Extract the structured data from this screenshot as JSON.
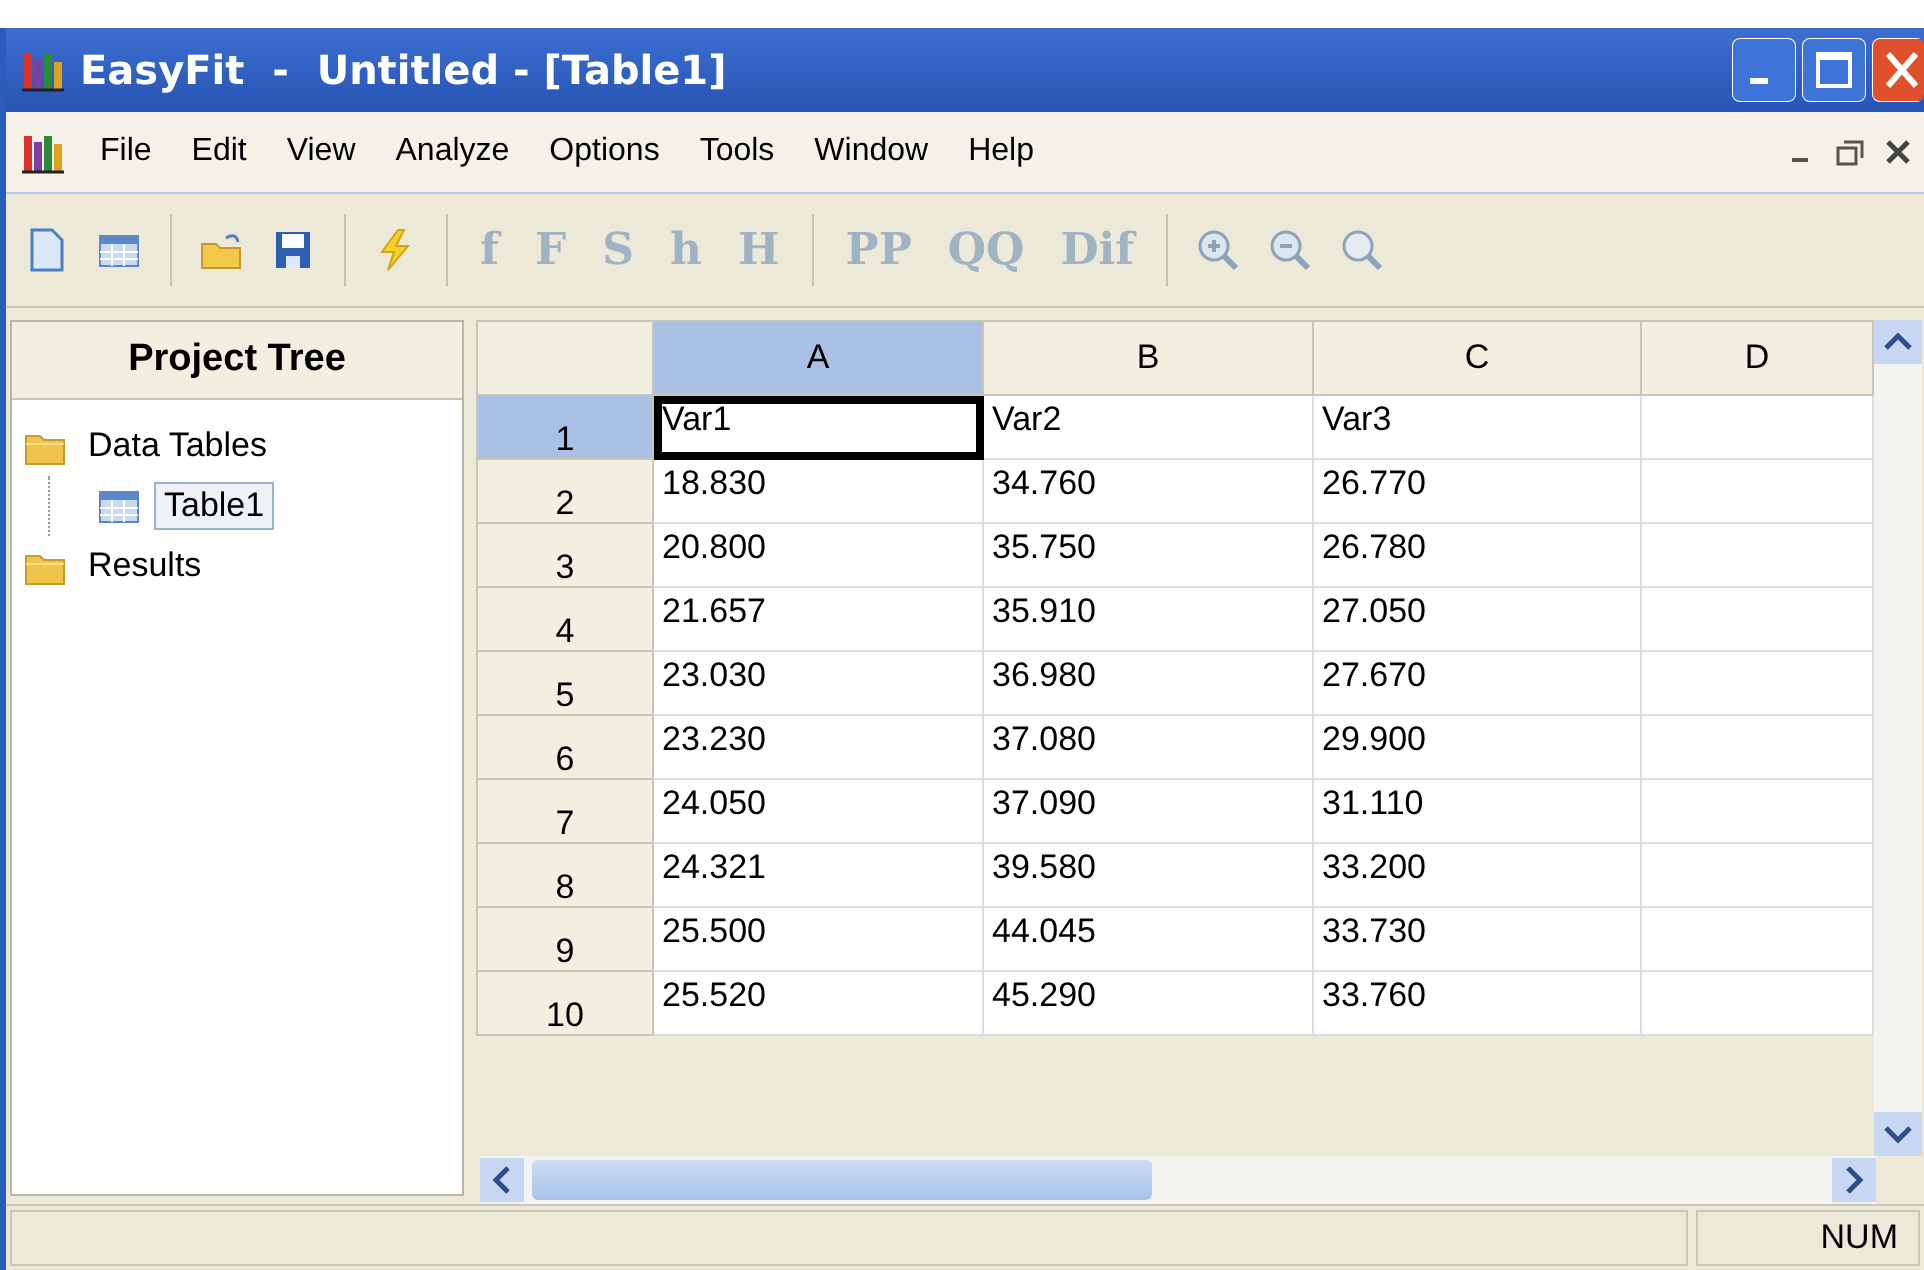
{
  "window": {
    "title": "EasyFit  -  Untitled - [Table1]"
  },
  "menu": [
    "File",
    "Edit",
    "View",
    "Analyze",
    "Options",
    "Tools",
    "Window",
    "Help"
  ],
  "toolbar": [
    {
      "kind": "icon"
    },
    {
      "kind": "icon"
    },
    {
      "kind": "separator"
    },
    {
      "kind": "icon"
    },
    {
      "kind": "icon"
    },
    {
      "kind": "separator"
    },
    {
      "kind": "icon"
    },
    {
      "kind": "separator"
    },
    {
      "kind": "text",
      "label": "f",
      "disabled": true
    },
    {
      "kind": "text",
      "label": "F",
      "disabled": true
    },
    {
      "kind": "text",
      "label": "S",
      "disabled": true
    },
    {
      "kind": "text",
      "label": "h",
      "disabled": true
    },
    {
      "kind": "text",
      "label": "H",
      "disabled": true
    },
    {
      "kind": "separator"
    },
    {
      "kind": "text",
      "label": "PP",
      "disabled": true
    },
    {
      "kind": "text",
      "label": "QQ",
      "disabled": true
    },
    {
      "kind": "text",
      "label": "Dif",
      "disabled": true
    },
    {
      "kind": "separator"
    },
    {
      "kind": "icon"
    },
    {
      "kind": "icon"
    },
    {
      "kind": "icon"
    }
  ],
  "sidebar": {
    "title": "Project Tree",
    "items": [
      {
        "label": "Data Tables",
        "kind": "folder",
        "selected": false,
        "children": [
          {
            "label": "Table1",
            "kind": "table",
            "selected": true
          }
        ]
      },
      {
        "label": "Results",
        "kind": "folder",
        "selected": false
      }
    ]
  },
  "table": {
    "columns": [
      {
        "label": "A",
        "selected": true
      },
      {
        "label": "B",
        "selected": false
      },
      {
        "label": "C",
        "selected": false
      },
      {
        "label": "D",
        "selected": false
      }
    ],
    "rows": [
      {
        "number": "1",
        "selected": true,
        "cells": [
          {
            "text": "Var1",
            "selected": true
          },
          {
            "text": "Var2",
            "selected": false
          },
          {
            "text": "Var3",
            "selected": false
          }
        ]
      },
      {
        "number": "2",
        "selected": false,
        "cells": [
          {
            "text": "18.830",
            "selected": false
          },
          {
            "text": "34.760",
            "selected": false
          },
          {
            "text": "26.770",
            "selected": false
          }
        ]
      },
      {
        "number": "3",
        "selected": false,
        "cells": [
          {
            "text": "20.800",
            "selected": false
          },
          {
            "text": "35.750",
            "selected": false
          },
          {
            "text": "26.780",
            "selected": false
          }
        ]
      },
      {
        "number": "4",
        "selected": false,
        "cells": [
          {
            "text": "21.657",
            "selected": false
          },
          {
            "text": "35.910",
            "selected": false
          },
          {
            "text": "27.050",
            "selected": false
          }
        ]
      },
      {
        "number": "5",
        "selected": false,
        "cells": [
          {
            "text": "23.030",
            "selected": false
          },
          {
            "text": "36.980",
            "selected": false
          },
          {
            "text": "27.670",
            "selected": false
          }
        ]
      },
      {
        "number": "6",
        "selected": false,
        "cells": [
          {
            "text": "23.230",
            "selected": false
          },
          {
            "text": "37.080",
            "selected": false
          },
          {
            "text": "29.900",
            "selected": false
          }
        ]
      },
      {
        "number": "7",
        "selected": false,
        "cells": [
          {
            "text": "24.050",
            "selected": false
          },
          {
            "text": "37.090",
            "selected": false
          },
          {
            "text": "31.110",
            "selected": false
          }
        ]
      },
      {
        "number": "8",
        "selected": false,
        "cells": [
          {
            "text": "24.321",
            "selected": false
          },
          {
            "text": "39.580",
            "selected": false
          },
          {
            "text": "33.200",
            "selected": false
          }
        ]
      },
      {
        "number": "9",
        "selected": false,
        "cells": [
          {
            "text": "25.500",
            "selected": false
          },
          {
            "text": "44.045",
            "selected": false
          },
          {
            "text": "33.730",
            "selected": false
          }
        ]
      },
      {
        "number": "10",
        "selected": false,
        "cells": [
          {
            "text": "25.520",
            "selected": false
          },
          {
            "text": "45.290",
            "selected": false
          },
          {
            "text": "33.760",
            "selected": false
          }
        ]
      }
    ]
  },
  "status_bar": {
    "indicator": "NUM"
  }
}
